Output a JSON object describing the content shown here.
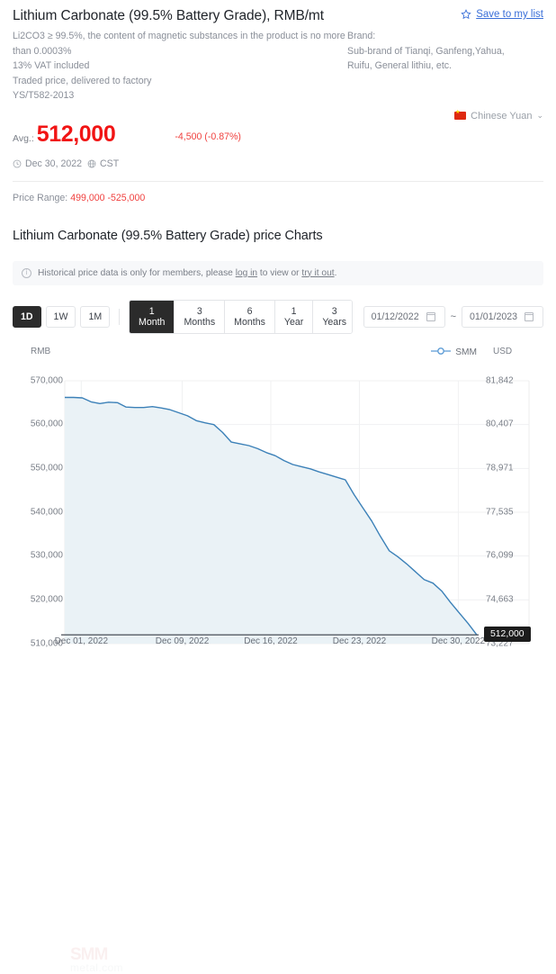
{
  "header": {
    "title": "Lithium Carbonate (99.5% Battery Grade), RMB/mt",
    "save_label": "Save to my list",
    "save_icon": "star-icon",
    "specs_left": [
      "Li2CO3 ≥ 99.5%, the content of magnetic substances in the product is no more",
      "than 0.0003%",
      "13% VAT included",
      "Traded price, delivered to factory",
      "YS/T582-2013"
    ],
    "specs_right": [
      "Brand:",
      "Sub-brand of Tianqi, Ganfeng,Yahua,",
      "Ruifu, General lithiu, etc."
    ]
  },
  "price": {
    "avg_label": "Avg.:",
    "avg_value": "512,000",
    "avg_color": "#f11414",
    "delta": "-4,500 (-0.87%)",
    "delta_color": "#f0413f",
    "date": "Dec 30, 2022",
    "timezone": "CST",
    "clock_icon": "clock-icon",
    "globe_icon": "globe-icon",
    "range_label": "Price Range:",
    "range_value": "499,000 -525,000",
    "currency": "Chinese Yuan",
    "currency_flag": "china-flag-icon",
    "currency_chevron": "chevron-down-icon"
  },
  "chart_section": {
    "title": "Lithium Carbonate (99.5% Battery Grade) price Charts",
    "notice_icon": "info-icon",
    "notice_pre": "Historical price data is only for members, please",
    "notice_link1": "log in",
    "notice_mid": "to view or",
    "notice_link2": "try it out",
    "notice_post": ".",
    "interval_buttons": [
      {
        "label": "1D",
        "active": true
      },
      {
        "label": "1W",
        "active": false
      },
      {
        "label": "1M",
        "active": false
      }
    ],
    "range_buttons": [
      {
        "label": "1 Month",
        "active": true
      },
      {
        "label": "3 Months",
        "active": false
      },
      {
        "label": "6 Months",
        "active": false
      },
      {
        "label": "1 Year",
        "active": false
      },
      {
        "label": "3 Years",
        "active": false
      }
    ],
    "date_from": "01/12/2022",
    "date_to": "01/01/2023",
    "date_sep": "~",
    "calendar_icon": "calendar-icon",
    "watermark_line1": "SMM",
    "watermark_line2": "metal.com"
  },
  "chart_data": {
    "type": "area",
    "title": "Lithium Carbonate (99.5% Battery Grade) price Charts",
    "series": [
      {
        "name": "SMM",
        "color": "#3c81b8",
        "fill": "#eaf2f6",
        "values": [
          566200,
          566200,
          566100,
          565200,
          564800,
          565100,
          565000,
          564000,
          563900,
          563900,
          564100,
          563800,
          563400,
          562700,
          562000,
          560900,
          560400,
          560000,
          558200,
          556000,
          555600,
          555200,
          554500,
          553600,
          552900,
          551800,
          550900,
          550400,
          549900,
          549200,
          548600,
          548000,
          547400,
          544000,
          541000,
          538000,
          534500,
          531200,
          529800,
          528200,
          526400,
          524600,
          523800,
          522000,
          519400,
          517000,
          514600,
          512000
        ]
      }
    ],
    "x": [
      "Dec 01, 2022",
      "Dec 09, 2022",
      "Dec 16, 2022",
      "Dec 23, 2022",
      "Dec 30, 2022"
    ],
    "xtick_positions": [
      0.04,
      0.285,
      0.5,
      0.715,
      0.955
    ],
    "legend": [
      "SMM"
    ],
    "legend_position": "top-right",
    "ylabel_left": "RMB",
    "ylabel_right": "USD",
    "yticks_left": [
      "570,000",
      "560,000",
      "550,000",
      "540,000",
      "530,000",
      "520,000",
      "510,000"
    ],
    "yticks_right": [
      "81,842",
      "80,407",
      "78,971",
      "77,535",
      "76,099",
      "74,663",
      "73,227"
    ],
    "ylim": [
      510000,
      570000
    ],
    "grid": true,
    "annotation": {
      "label": "512,000",
      "value": 512000
    }
  }
}
